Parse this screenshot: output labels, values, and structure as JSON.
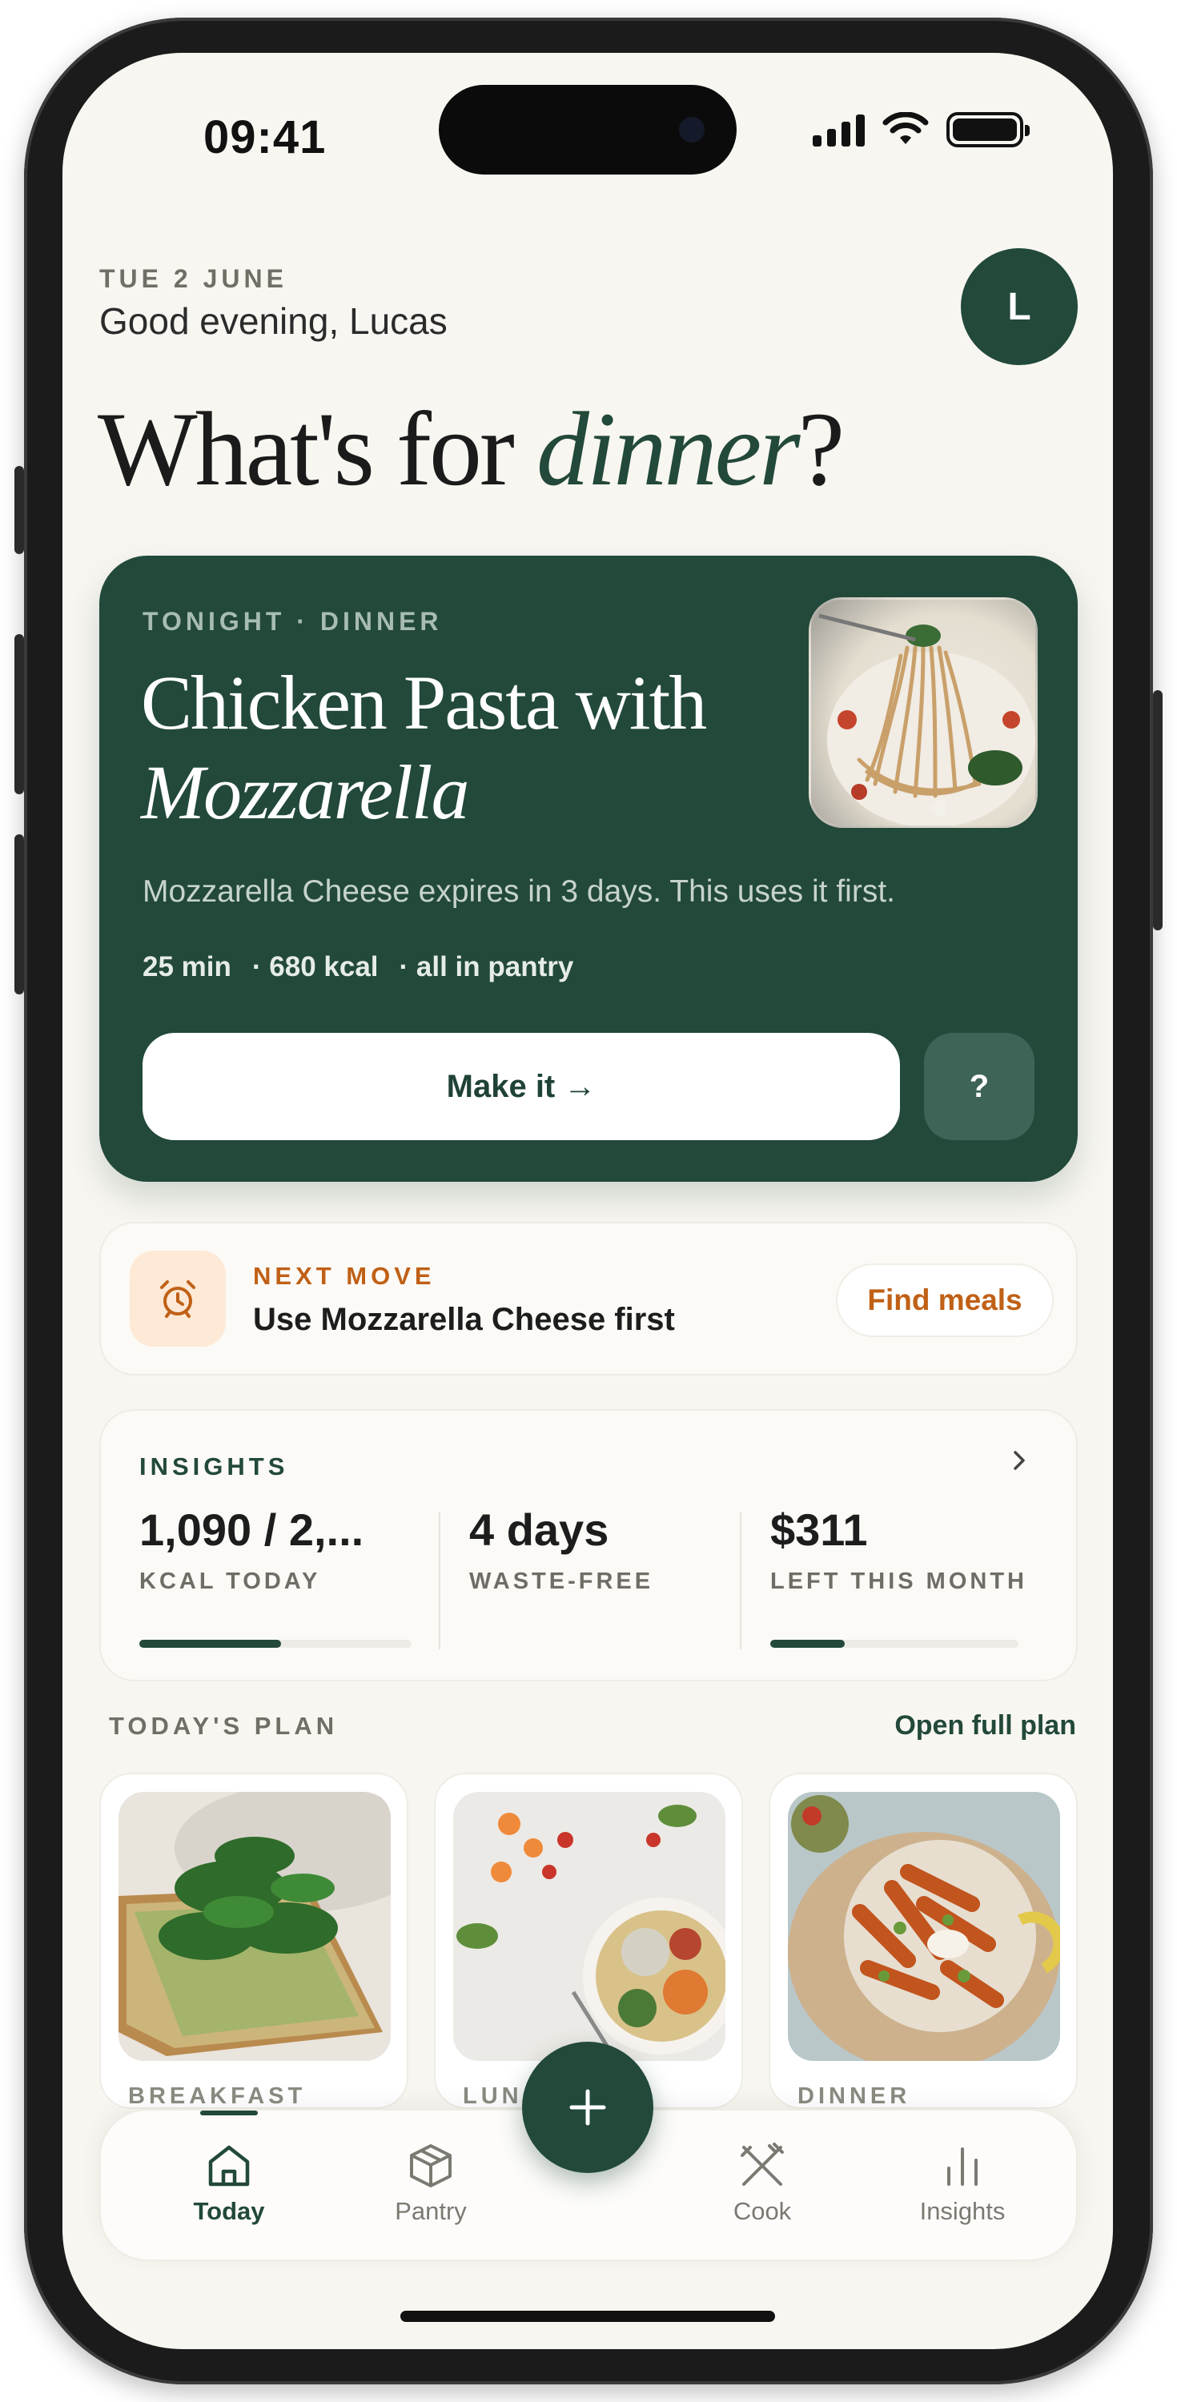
{
  "status_bar": {
    "time": "09:41"
  },
  "header": {
    "date": "TUE 2 JUNE",
    "greeting": "Good evening, Lucas",
    "avatar_initial": "L",
    "headline_prefix": "What's for ",
    "headline_emphasis": "dinner",
    "headline_suffix": "?"
  },
  "hero": {
    "kicker": "TONIGHT · DINNER",
    "title_line1": "Chicken Pasta with",
    "title_line2": "Mozzarella",
    "description": "Mozzarella Cheese expires in 3 days. This uses it first.",
    "meta": [
      "25 min",
      "· 680 kcal",
      "· all in pantry"
    ],
    "primary_button": "Make it →",
    "secondary_button": "?",
    "photo_icon": "pasta-photo"
  },
  "next_move": {
    "kicker": "NEXT MOVE",
    "text": "Use Mozzarella Cheese first",
    "button": "Find meals",
    "icon": "alarm-clock-icon"
  },
  "insights": {
    "title": "INSIGHTS",
    "stats": [
      {
        "value": "1,090 / 2,...",
        "label": "KCAL TODAY",
        "progress": 0.52
      },
      {
        "value": "4 days",
        "label": "WASTE-FREE"
      },
      {
        "value": "$311",
        "label": "LEFT THIS MONTH",
        "progress": 0.3
      }
    ]
  },
  "plan": {
    "title": "TODAY'S PLAN",
    "link": "Open full plan",
    "meals": [
      {
        "label": "BREAKFAST",
        "photo": "avocado-toast-photo"
      },
      {
        "label": "LUNCH",
        "photo": "salad-bowl-photo"
      },
      {
        "label": "DINNER",
        "photo": "sweet-potato-plate-photo"
      }
    ]
  },
  "tabbar": {
    "tabs": [
      {
        "label": "Today",
        "icon": "home-icon",
        "active": true
      },
      {
        "label": "Pantry",
        "icon": "box-icon",
        "active": false
      },
      {
        "label": "Cook",
        "icon": "utensils-icon",
        "active": false
      },
      {
        "label": "Insights",
        "icon": "bar-chart-icon",
        "active": false
      }
    ],
    "fab_icon": "plus-icon"
  },
  "colors": {
    "brand": "#22493a",
    "accent": "#c06016",
    "background": "#f8f6f1"
  }
}
